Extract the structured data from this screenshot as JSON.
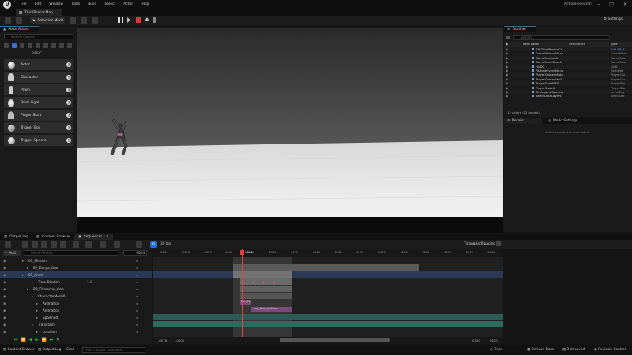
{
  "menubar": {
    "items": [
      "File",
      "Edit",
      "Window",
      "Tools",
      "Build",
      "Select",
      "Actor",
      "Help"
    ],
    "project": "ActionResearch"
  },
  "tab": {
    "label": "ThirdPersonMap"
  },
  "toolbar": {
    "selection_mode": "Selection Mode",
    "settings": "Settings"
  },
  "place_actors": {
    "tab": "Place Actors",
    "search_placeholder": "Search Classes",
    "category": "BASIC",
    "items": [
      "Actor",
      "Character",
      "Pawn",
      "Point Light",
      "Player Start",
      "Trigger Box",
      "Trigger Sphere"
    ]
  },
  "outliner": {
    "tab": "Outliner",
    "search_placeholder": "Search...",
    "col_label": "Item Label",
    "col_sequencer": "Sequencer",
    "col_type": "Type",
    "rows": [
      {
        "name": "BP_ThirdPersonCh",
        "type": "Edit BP_T"
      },
      {
        "name": "GameNetworkMan",
        "type": "GameNetw"
      },
      {
        "name": "GameSession0",
        "type": "GameSess"
      },
      {
        "name": "GameStateBase0",
        "type": "GameStat"
      },
      {
        "name": "HUD0",
        "type": "HUD"
      },
      {
        "name": "ParticleEventMana",
        "type": "ParticleE"
      },
      {
        "name": "PlayerCameraMan",
        "type": "PlayerCar"
      },
      {
        "name": "PlayerController0",
        "type": "PlayerCor"
      },
      {
        "name": "PlayerStartPIE0",
        "type": "PlayerSta"
      },
      {
        "name": "PlayerState0",
        "type": "PlayerSta"
      },
      {
        "name": "TimingAndSpacing",
        "type": "LevelSeq"
      },
      {
        "name": "WorldDataLayers",
        "type": "WorldDat"
      }
    ],
    "count": "12 actors (12 loaded)"
  },
  "details": {
    "tab": "Details",
    "tab2": "World Settings",
    "empty": "Select an object to view details."
  },
  "bottom_tabs": [
    "Output Log",
    "Content Browser",
    "Sequencer"
  ],
  "sequencer": {
    "fps": "30 fps",
    "sequence_name": "TimingAndSpacing_01",
    "add_label": "Add",
    "search_placeholder": "Search Tracks",
    "frame": "0004",
    "playhead_label": "0004",
    "ruler": [
      "-0100",
      "-0050",
      "-0025",
      "0000",
      "0025",
      "0050",
      "0075",
      "0100",
      "0125",
      "0150",
      "0175",
      "0200",
      "0225",
      "0250",
      "0275",
      "0300"
    ],
    "tracks": [
      {
        "name": "01_Mission",
        "indent": 1
      },
      {
        "name": "BP_Zenya_One",
        "indent": 2
      },
      {
        "name": "01_Anim",
        "indent": 1,
        "selected": true
      },
      {
        "name": "Time Dilation",
        "indent": 3,
        "value": "1.0"
      },
      {
        "name": "BP_Character_One",
        "indent": 2
      },
      {
        "name": "CharacterMesh0",
        "indent": 3
      },
      {
        "name": "Animation",
        "indent": 4
      },
      {
        "name": "Animation",
        "indent": 4
      },
      {
        "name": "Spawned",
        "indent": 4
      },
      {
        "name": "Transform",
        "indent": 3
      },
      {
        "name": "Location",
        "indent": 4
      }
    ],
    "clip1": "Run_Fwd",
    "clip2": "Jmp_Rose_A_Cover",
    "start_frame": "-0078",
    "end_frame": "0300",
    "left_readout": "-0300",
    "right_readout": "0620"
  },
  "statusbar": {
    "content_drawer": "Content Drawer",
    "output_log": "Output Log",
    "cmd": "Cmd",
    "console_placeholder": "Enter Console Command",
    "trace": "Trace",
    "derived": "Derived Data",
    "unsaved": "3 Unsaved",
    "revision": "Revision Control"
  }
}
